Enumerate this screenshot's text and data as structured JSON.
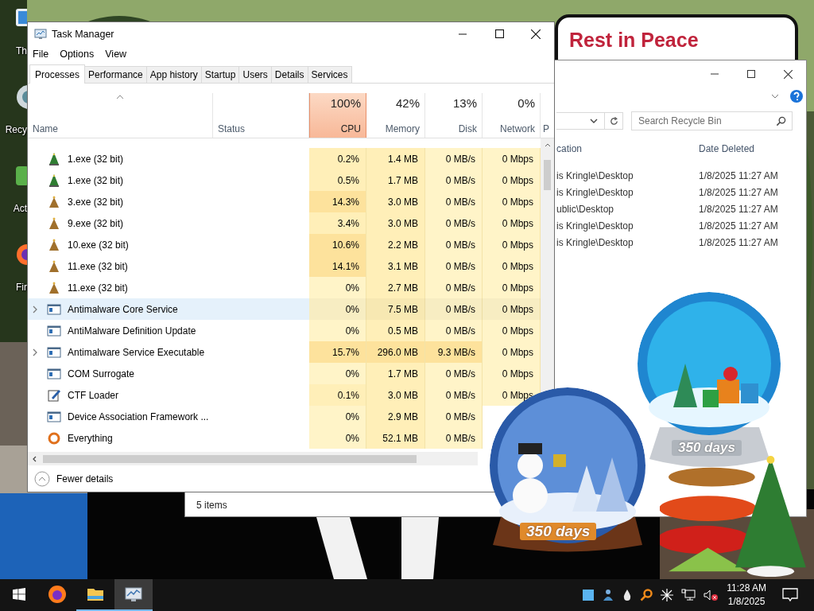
{
  "desktop": {
    "icons": [
      {
        "kind": "monitor",
        "label": "Th"
      },
      {
        "kind": "bin",
        "label": "Recy"
      },
      {
        "kind": "app",
        "label": "Act"
      },
      {
        "kind": "fox",
        "label": "Fir"
      }
    ],
    "note": {
      "text": "Rest in Peace"
    },
    "gadgets": [
      {
        "kind": "globe-gifts",
        "label": "350 days"
      },
      {
        "kind": "globe-snowman",
        "label": "350 days"
      },
      {
        "kind": "tree-spring"
      }
    ]
  },
  "recycle_bin": {
    "search": {
      "placeholder": "Search Recycle Bin"
    },
    "columns": [
      "cation",
      "Date Deleted"
    ],
    "rows": [
      {
        "location": "is Kringle\\Desktop",
        "date_deleted": "1/8/2025 11:27 AM"
      },
      {
        "location": "is Kringle\\Desktop",
        "date_deleted": "1/8/2025 11:27 AM"
      },
      {
        "location": "ublic\\Desktop",
        "date_deleted": "1/8/2025 11:27 AM"
      },
      {
        "location": "is Kringle\\Desktop",
        "date_deleted": "1/8/2025 11:27 AM"
      },
      {
        "location": "is Kringle\\Desktop",
        "date_deleted": "1/8/2025 11:27 AM"
      }
    ],
    "status_bar": "5 items"
  },
  "task_manager": {
    "title": "Task Manager",
    "menu": [
      "File",
      "Options",
      "View"
    ],
    "tabs": [
      {
        "label": "Processes",
        "selected": true
      },
      {
        "label": "Performance",
        "selected": false
      },
      {
        "label": "App history",
        "selected": false
      },
      {
        "label": "Startup",
        "selected": false
      },
      {
        "label": "Users",
        "selected": false
      },
      {
        "label": "Details",
        "selected": false
      },
      {
        "label": "Services",
        "selected": false
      }
    ],
    "columns": [
      {
        "kind": "name",
        "label": "Name",
        "sorted": true,
        "selected": false
      },
      {
        "kind": "status",
        "label": "Status",
        "sorted": false,
        "selected": false
      },
      {
        "kind": "cpu",
        "percent": "100%",
        "label": "CPU",
        "sorted": false,
        "selected": true
      },
      {
        "kind": "memory",
        "percent": "42%",
        "label": "Memory",
        "sorted": false,
        "selected": false
      },
      {
        "kind": "disk",
        "percent": "13%",
        "label": "Disk",
        "sorted": false,
        "selected": false
      },
      {
        "kind": "network",
        "percent": "0%",
        "label": "Network",
        "sorted": false,
        "selected": false
      },
      {
        "kind": "cut",
        "label": "P",
        "sorted": false,
        "selected": false
      }
    ],
    "rows": [
      {
        "kind": "tree-star",
        "name": "1.exe (32 bit)",
        "expandable": false,
        "selected": false,
        "cpu": "0.2%",
        "memory": "1.4 MB",
        "disk": "0 MB/s",
        "network": "0 Mbps"
      },
      {
        "kind": "tree-star",
        "name": "1.exe (32 bit)",
        "expandable": false,
        "selected": false,
        "cpu": "0.5%",
        "memory": "1.7 MB",
        "disk": "0 MB/s",
        "network": "0 Mbps"
      },
      {
        "kind": "tree",
        "name": "3.exe (32 bit)",
        "expandable": false,
        "selected": false,
        "cpu": "14.3%",
        "memory": "3.0 MB",
        "disk": "0 MB/s",
        "network": "0 Mbps"
      },
      {
        "kind": "tree",
        "name": "9.exe (32 bit)",
        "expandable": false,
        "selected": false,
        "cpu": "3.4%",
        "memory": "3.0 MB",
        "disk": "0 MB/s",
        "network": "0 Mbps"
      },
      {
        "kind": "tree",
        "name": "10.exe (32 bit)",
        "expandable": false,
        "selected": false,
        "cpu": "10.6%",
        "memory": "2.2 MB",
        "disk": "0 MB/s",
        "network": "0 Mbps"
      },
      {
        "kind": "tree",
        "name": "11.exe (32 bit)",
        "expandable": false,
        "selected": false,
        "cpu": "14.1%",
        "memory": "3.1 MB",
        "disk": "0 MB/s",
        "network": "0 Mbps"
      },
      {
        "kind": "tree",
        "name": "11.exe (32 bit)",
        "expandable": false,
        "selected": false,
        "cpu": "0%",
        "memory": "2.7 MB",
        "disk": "0 MB/s",
        "network": "0 Mbps"
      },
      {
        "kind": "service",
        "name": "Antimalware Core Service",
        "expandable": true,
        "selected": true,
        "cpu": "0%",
        "memory": "7.5 MB",
        "disk": "0 MB/s",
        "network": "0 Mbps"
      },
      {
        "kind": "service",
        "name": "AntiMalware Definition Update",
        "expandable": false,
        "selected": false,
        "cpu": "0%",
        "memory": "0.5 MB",
        "disk": "0 MB/s",
        "network": "0 Mbps"
      },
      {
        "kind": "service",
        "name": "Antimalware Service Executable",
        "expandable": true,
        "selected": false,
        "cpu": "15.7%",
        "memory": "296.0 MB",
        "disk": "9.3 MB/s",
        "network": "0 Mbps"
      },
      {
        "kind": "service",
        "name": "COM Surrogate",
        "expandable": false,
        "selected": false,
        "cpu": "0%",
        "memory": "1.7 MB",
        "disk": "0 MB/s",
        "network": "0 Mbps"
      },
      {
        "kind": "pen",
        "name": "CTF Loader",
        "expandable": false,
        "selected": false,
        "cpu": "0.1%",
        "memory": "3.0 MB",
        "disk": "0 MB/s",
        "network": "0 Mbps"
      },
      {
        "kind": "service",
        "name": "Device Association Framework ...",
        "expandable": false,
        "selected": false,
        "cpu": "0%",
        "memory": "2.9 MB",
        "disk": "0 MB/s"
      },
      {
        "kind": "ring",
        "name": "Everything",
        "expandable": false,
        "selected": false,
        "cpu": "0%",
        "memory": "52.1 MB",
        "disk": "0 MB/s"
      }
    ],
    "footer": "Fewer details"
  },
  "taskbar": {
    "apps": [
      {
        "kind": "firefox",
        "running": false,
        "active": false
      },
      {
        "kind": "folder",
        "running": true,
        "active": false
      },
      {
        "kind": "task-manager",
        "running": true,
        "active": true
      }
    ],
    "clock": {
      "time": "11:28 AM",
      "date": "1/8/2025"
    }
  }
}
